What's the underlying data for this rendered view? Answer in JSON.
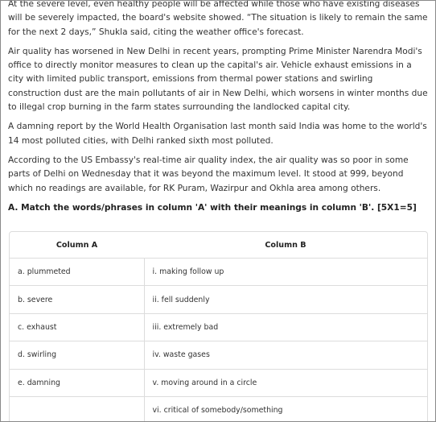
{
  "paragraphs": [
    "At the severe level, even healthy people will be affected while those who have existing diseases will be severely impacted, the board's website showed. “The situation is likely to remain the same for the next 2 days,” Shukla said, citing the weather office's forecast.",
    "Air quality has worsened in New Delhi in recent years, prompting Prime Minister Narendra Modi's office to directly monitor measures to clean up the capital's air. Vehicle exhaust emissions in a city with limited public transport, emissions from thermal power stations and swirling construction dust are the main pollutants of air in New Delhi, which worsens in winter months due to illegal crop burning in the farm states surrounding the landlocked capital city.",
    "A damning report by the World Health Organisation last month said India was home to the world's 14 most polluted cities, with Delhi ranked sixth most polluted.",
    "According to the US Embassy's real-time air quality index, the air quality was so poor in some parts of Delhi on Wednesday that it was beyond the maximum level. It stood at 999, beyond which no readings are available, for RK Puram, Wazirpur and Okhla area among others."
  ],
  "question": {
    "heading": "A. Match the words/phrases in column 'A' with their meanings in column 'B'. [5X1=5]"
  },
  "table": {
    "header_a": "Column A",
    "header_b": "Column B",
    "rows": [
      {
        "a": "a. plummeted",
        "b": "i. making follow up"
      },
      {
        "a": "b. severe",
        "b": "ii. fell suddenly"
      },
      {
        "a": "c. exhaust",
        "b": "iii. extremely bad"
      },
      {
        "a": "d. swirling",
        "b": "iv. waste gases"
      },
      {
        "a": "e. damning",
        "b": "v. moving around in a circle"
      },
      {
        "a": "",
        "b": "vi. critical of somebody/something"
      }
    ]
  }
}
